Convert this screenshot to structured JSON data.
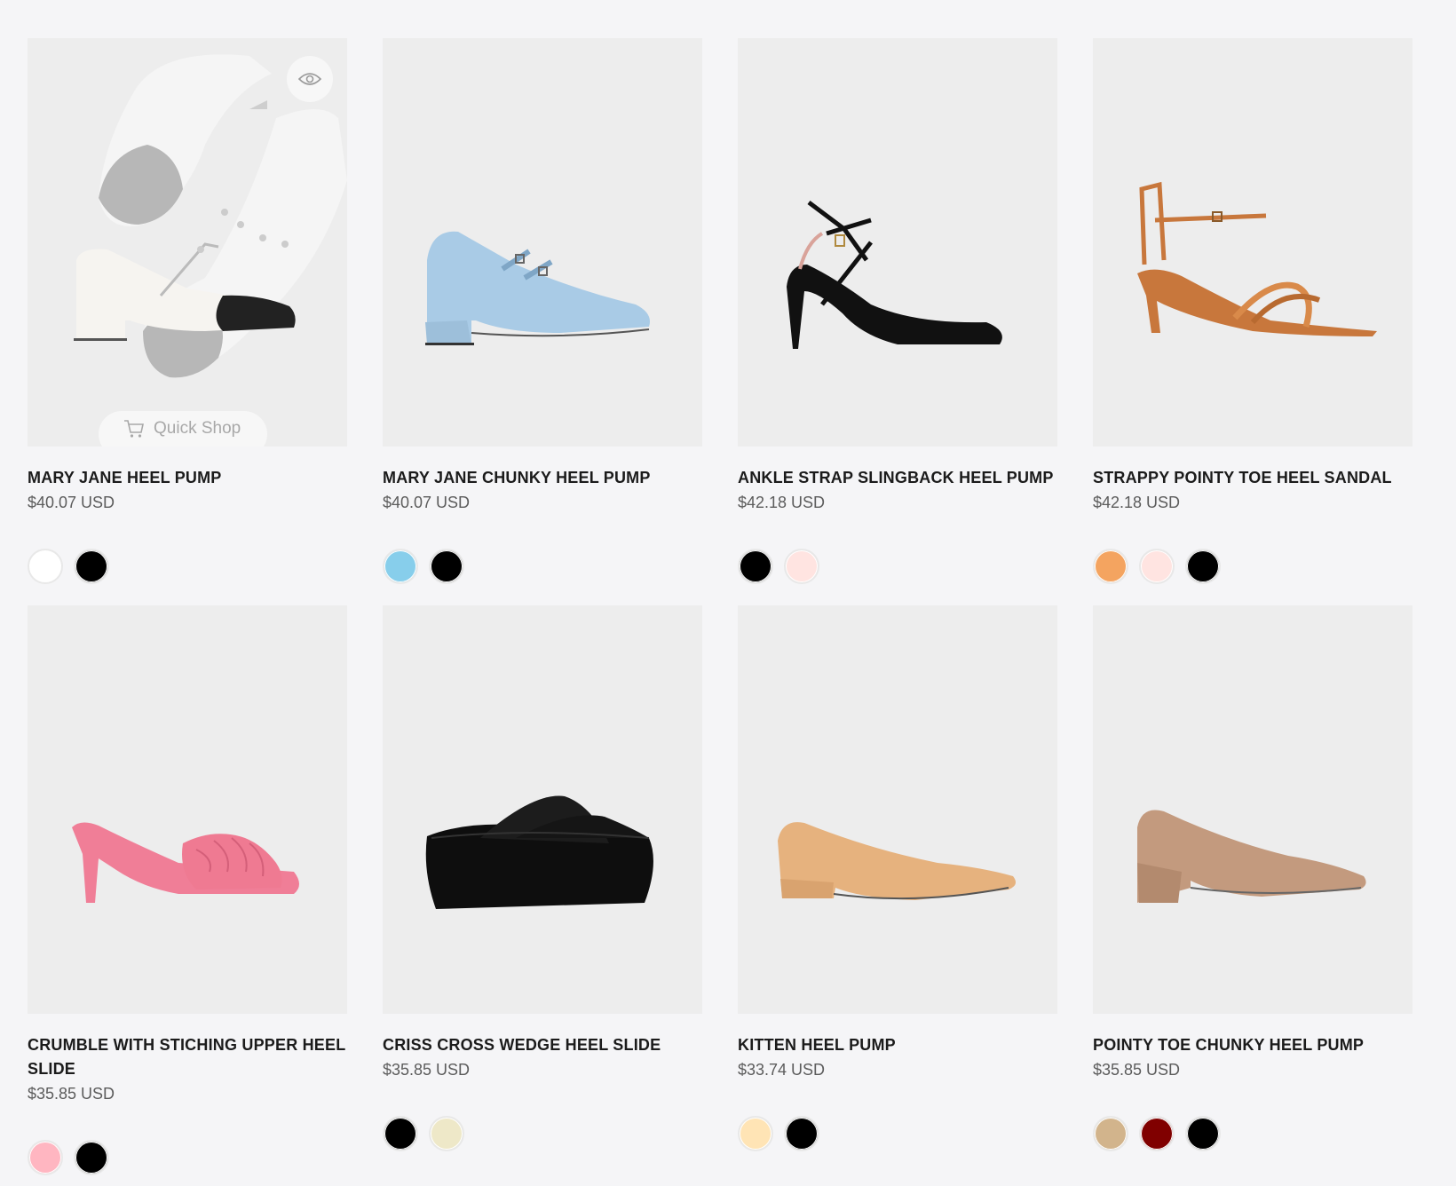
{
  "quick_shop_label": "Quick Shop",
  "products": [
    {
      "name": "MARY JANE HEEL PUMP",
      "price": "$40.07 USD",
      "swatches": [
        "#ffffff",
        "#000000"
      ]
    },
    {
      "name": "MARY JANE CHUNKY HEEL PUMP",
      "price": "$40.07 USD",
      "swatches": [
        "#87ceeb",
        "#000000"
      ]
    },
    {
      "name": "ANKLE STRAP SLINGBACK HEEL PUMP",
      "price": "$42.18 USD",
      "swatches": [
        "#000000",
        "#ffe4e1"
      ]
    },
    {
      "name": "STRAPPY POINTY TOE HEEL SANDAL",
      "price": "$42.18 USD",
      "swatches": [
        "#f4a460",
        "#ffe4e1",
        "#000000"
      ]
    },
    {
      "name": "CRUMBLE WITH STICHING UPPER HEEL SLIDE",
      "price": "$35.85 USD",
      "swatches": [
        "#ffb6c1",
        "#000000"
      ]
    },
    {
      "name": "CRISS CROSS WEDGE HEEL SLIDE",
      "price": "$35.85 USD",
      "swatches": [
        "#000000",
        "#eee8c8"
      ]
    },
    {
      "name": "KITTEN HEEL PUMP",
      "price": "$33.74 USD",
      "swatches": [
        "#ffe4b5",
        "#000000"
      ]
    },
    {
      "name": "POINTY TOE CHUNKY HEEL PUMP",
      "price": "$35.85 USD",
      "swatches": [
        "#d2b48c",
        "#800000",
        "#000000"
      ]
    }
  ]
}
